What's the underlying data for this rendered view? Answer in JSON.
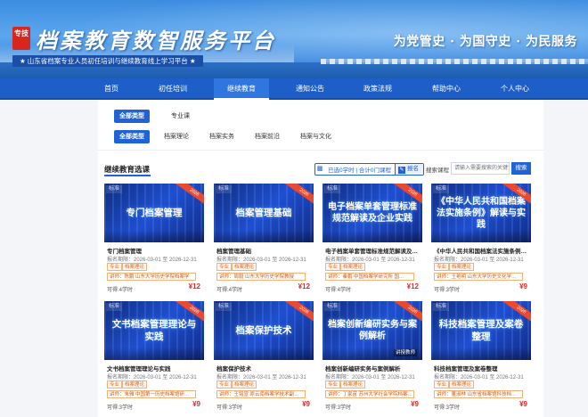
{
  "header": {
    "seal_text": "专技",
    "title": "档案教育数智服务平台",
    "subtitle": "★ 山东省档案专业人员初任培训与继续教育线上学习平台 ★",
    "slogan": "为党管史 · 为国守史 · 为民服务"
  },
  "nav": {
    "items": [
      {
        "label": "首页"
      },
      {
        "label": "初任培训"
      },
      {
        "label": "继续教育",
        "active": true
      },
      {
        "label": "通知公告"
      },
      {
        "label": "政策法规"
      },
      {
        "label": "帮助中心"
      },
      {
        "label": "个人中心"
      }
    ]
  },
  "filters": {
    "row1": [
      "全部类型",
      "专业课"
    ],
    "row2": [
      "全部类型",
      "档案理论",
      "档案实务",
      "档案前沿",
      "档案与文化"
    ]
  },
  "section": {
    "title": "继续教育选课",
    "status_text": "已选0学时 | 合计0门课程",
    "report_label": "报名",
    "search_label": "搜索课程",
    "search_placeholder": "请输入需要搜索的关键词",
    "search_button": "搜索"
  },
  "courses": [
    {
      "tag": "标准",
      "ribbon": "2026",
      "thumb_title": "专门档案管理",
      "name": "专门档案管理",
      "period": "报名期限：2026-03-01 至 2026-12-31",
      "badge": "专业",
      "category": "档案理论",
      "detail": "讲师：陈鹏 山东大学历史学院档案学",
      "hours": "可得:4学时",
      "price": "¥12",
      "stamp": ""
    },
    {
      "tag": "标准",
      "ribbon": "2026",
      "thumb_title": "档案管理基础",
      "name": "档案管理基础",
      "period": "报名期限：2026-03-01 至 2026-12-31",
      "badge": "专业",
      "category": "档案理论",
      "detail": "讲师：周毅 山东大学历史学院教授",
      "hours": "可得:4学时",
      "price": "¥12",
      "stamp": ""
    },
    {
      "tag": "标准",
      "ribbon": "2026",
      "thumb_title": "电子档案单套管理标准规范解读及企业实践",
      "name": "电子档案单套管理标准规范解读及企…",
      "period": "报名期限：2026-03-01 至 2026-12-31",
      "badge": "专业",
      "category": "档案理论",
      "detail": "讲师：秦鹏 中国档案学研究所 国…",
      "hours": "可得:4学时",
      "price": "¥12",
      "stamp": ""
    },
    {
      "tag": "标准",
      "ribbon": "2026",
      "thumb_title": "《中华人民共和国档案法实施条例》解读与实践",
      "name": "《中华人民共和国档案法实施条例》…",
      "period": "报名期限：2026-03-01 至 2026-12-31",
      "badge": "专业",
      "category": "档案理论",
      "detail": "讲师：王艳明 山东大学历史文化学…",
      "hours": "可得:3学时",
      "price": "¥9",
      "stamp": ""
    },
    {
      "tag": "标准",
      "ribbon": "2026",
      "thumb_title": "文书档案管理理论与实践",
      "name": "文书档案管理理论与实践",
      "period": "报名期限：2026-03-01 至 2026-12-31",
      "badge": "专业",
      "category": "档案理论",
      "detail": "讲师：朱雅 中国第一历史档案馆研…",
      "hours": "可得:3学时",
      "price": "¥9",
      "stamp": ""
    },
    {
      "tag": "标准",
      "ribbon": "2026",
      "thumb_title": "档案保护技术",
      "name": "档案保护技术",
      "period": "报名期限：2026-03-01 至 2026-12-31",
      "badge": "专业",
      "category": "档案理论",
      "detail": "讲师：王铭宣 原云南档案学技术副…",
      "hours": "可得:3学时",
      "price": "¥9",
      "stamp": ""
    },
    {
      "tag": "标准",
      "ribbon": "2026",
      "thumb_title": "档案创新编研实务与案例解析",
      "name": "档案创新编研实务与案例解析",
      "period": "报名期限：2026-03-01 至 2026-12-31",
      "badge": "专业",
      "category": "档案理论",
      "detail": "讲师：丁家苗 苏州大学社会学院档案…",
      "hours": "可得:3学时",
      "price": "¥9",
      "stamp": "讲授教师"
    },
    {
      "tag": "标准",
      "ribbon": "2026",
      "thumb_title": "科技档案管理及案卷整理",
      "name": "科技档案管理及案卷整理",
      "period": "报名期限：2026-03-01 至 2026-12-31",
      "badge": "专业",
      "category": "档案理论",
      "detail": "讲师：董淑林 山东省档案馆科技档…",
      "hours": "可得:3学时",
      "price": "¥9",
      "stamp": ""
    }
  ]
}
